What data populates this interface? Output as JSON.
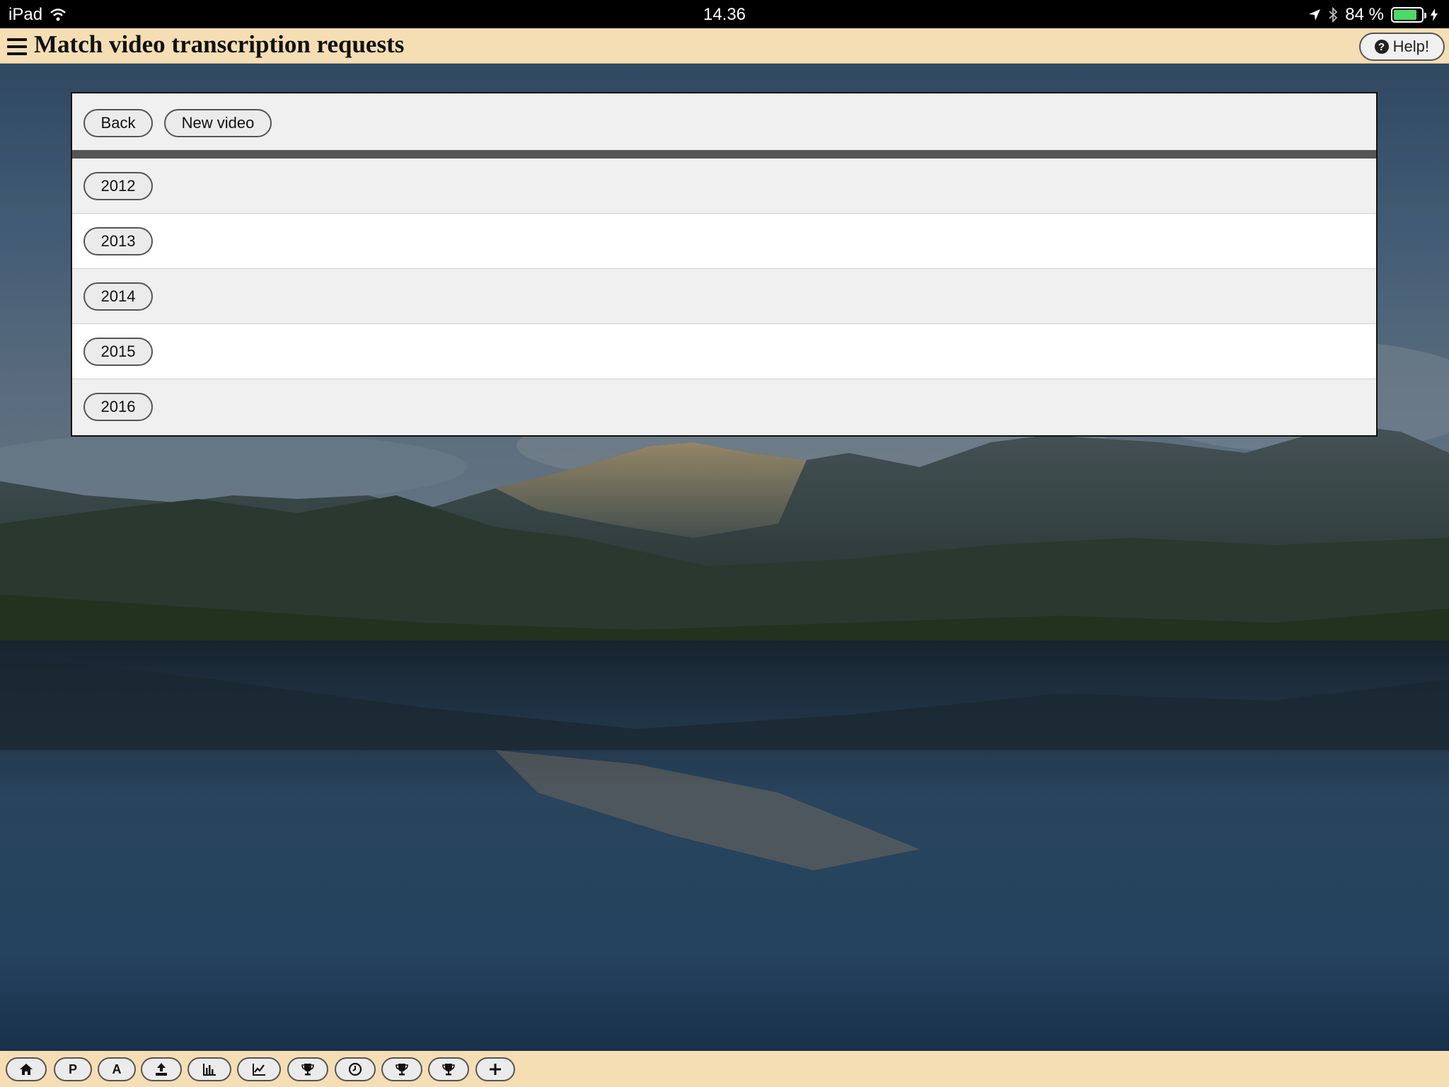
{
  "status_bar": {
    "device": "iPad",
    "time": "14.36",
    "battery": "84 %",
    "battery_level": 0.84
  },
  "header": {
    "title": "Match video transcription requests",
    "help_label": "Help!"
  },
  "toolbar": {
    "back_label": "Back",
    "new_video_label": "New video"
  },
  "years": [
    "2012",
    "2013",
    "2014",
    "2015",
    "2016"
  ],
  "bottom_toolbar": {
    "buttons": [
      {
        "icon": "home-icon"
      },
      {
        "label": "P"
      },
      {
        "label": "A"
      },
      {
        "icon": "upload-icon"
      },
      {
        "icon": "bar-chart-icon"
      },
      {
        "icon": "line-chart-icon"
      },
      {
        "icon": "trophy-icon"
      },
      {
        "icon": "clock-icon"
      },
      {
        "icon": "trophy-icon"
      },
      {
        "icon": "trophy-icon"
      },
      {
        "icon": "plus-icon"
      }
    ]
  },
  "colors": {
    "header_bg": "#f5deb3",
    "status_bar_bg": "#000000",
    "panel_bg": "#f0f0f0",
    "divider": "#555555"
  }
}
